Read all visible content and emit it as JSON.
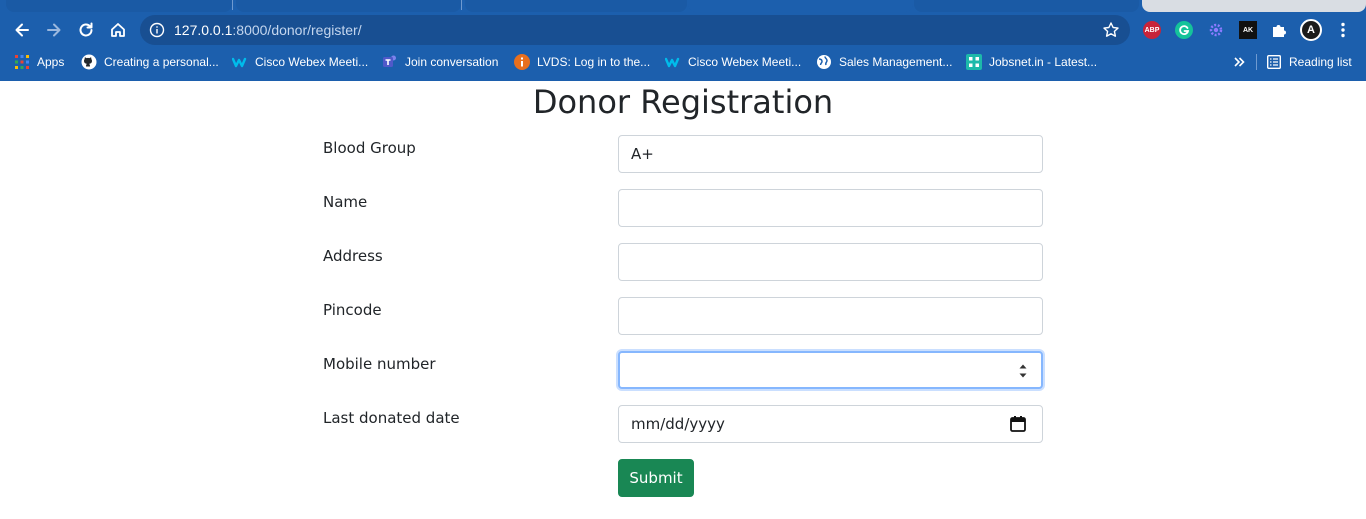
{
  "browser": {
    "url_host": "127.0.0.1",
    "url_rest": ":8000/donor/register/",
    "colors": {
      "chrome": "#1c5fad",
      "omnibox": "#184f92"
    },
    "extensions": [
      "adblock-plus",
      "grammarly",
      "gear-extension",
      "ak-extension",
      "extensions-puzzle",
      "profile-avatar",
      "menu"
    ],
    "extension_labels": {
      "abp": "ABP",
      "ak": "AK"
    },
    "bookmarks": [
      {
        "label": "Apps",
        "icon": "apps-grid-icon"
      },
      {
        "label": "Creating a personal...",
        "icon": "github-icon"
      },
      {
        "label": "Cisco Webex Meeti...",
        "icon": "webex-icon"
      },
      {
        "label": "Join conversation",
        "icon": "teams-icon"
      },
      {
        "label": "LVDS: Log in to the...",
        "icon": "lvds-icon"
      },
      {
        "label": "Cisco Webex Meeti...",
        "icon": "webex-icon"
      },
      {
        "label": "Sales Management...",
        "icon": "globe-icon"
      },
      {
        "label": "Jobsnet.in - Latest...",
        "icon": "jobsnet-icon"
      }
    ],
    "reading_list": "Reading list"
  },
  "page": {
    "title": "Donor Registration",
    "fields": [
      {
        "label": "Blood Group",
        "value": "A+"
      },
      {
        "label": "Name",
        "value": ""
      },
      {
        "label": "Address",
        "value": ""
      },
      {
        "label": "Pincode",
        "value": ""
      },
      {
        "label": "Mobile number",
        "value": ""
      },
      {
        "label": "Last donated date",
        "value": "mm/dd/yyyy"
      }
    ],
    "submit_label": "Submit",
    "colors": {
      "submit": "#198754",
      "focus_ring": "#86b7fe",
      "text": "#212529"
    }
  }
}
